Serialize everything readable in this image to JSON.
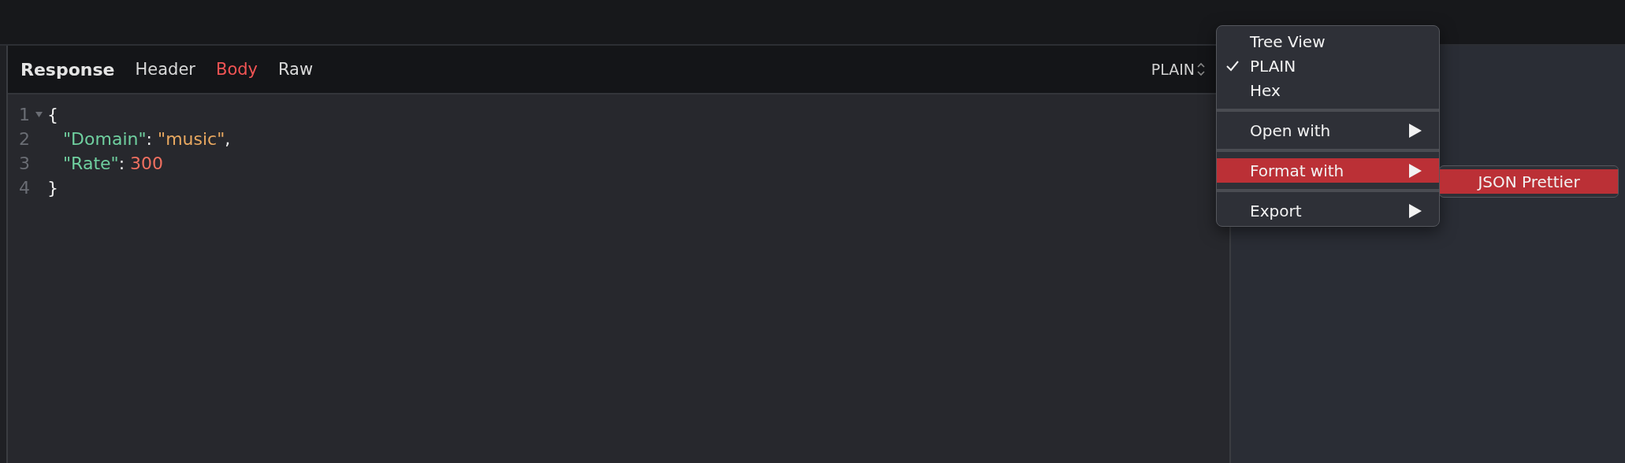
{
  "response_bar": {
    "title": "Response",
    "tabs": [
      {
        "label": "Header",
        "selected": false
      },
      {
        "label": "Body",
        "selected": true
      },
      {
        "label": "Raw",
        "selected": false
      }
    ],
    "format_select": {
      "value": "PLAIN"
    }
  },
  "code": [
    {
      "number": "1",
      "foldable": true,
      "tokens": [
        {
          "kind": "punct",
          "text": "{"
        }
      ]
    },
    {
      "number": "2",
      "foldable": false,
      "tokens": [
        {
          "kind": "key",
          "text": "\"Domain\""
        },
        {
          "kind": "punct",
          "text": ": "
        },
        {
          "kind": "string",
          "text": "\"music\""
        },
        {
          "kind": "punct",
          "text": ","
        }
      ]
    },
    {
      "number": "3",
      "foldable": false,
      "tokens": [
        {
          "kind": "key",
          "text": "\"Rate\""
        },
        {
          "kind": "punct",
          "text": ": "
        },
        {
          "kind": "number",
          "text": "300"
        }
      ]
    },
    {
      "number": "4",
      "foldable": false,
      "tokens": [
        {
          "kind": "punct",
          "text": "}"
        }
      ]
    }
  ],
  "context_menu": {
    "groups": [
      [
        {
          "label": "Tree View",
          "checked": false,
          "submenu": false,
          "selected": false
        },
        {
          "label": "PLAIN",
          "checked": true,
          "submenu": false,
          "selected": false
        },
        {
          "label": "Hex",
          "checked": false,
          "submenu": false,
          "selected": false
        }
      ],
      [
        {
          "label": "Open with",
          "checked": false,
          "submenu": true,
          "selected": false
        }
      ],
      [
        {
          "label": "Format with",
          "checked": false,
          "submenu": true,
          "selected": true
        }
      ],
      [
        {
          "label": "Export",
          "checked": false,
          "submenu": true,
          "selected": false
        }
      ]
    ],
    "submenu": [
      {
        "label": "JSON Prettier",
        "selected": true
      }
    ]
  }
}
